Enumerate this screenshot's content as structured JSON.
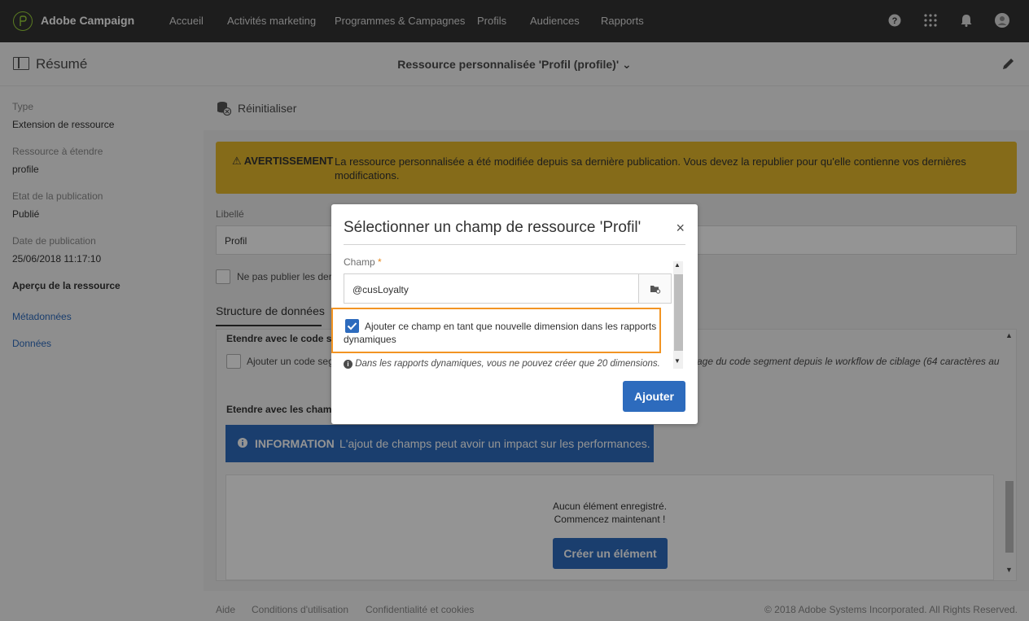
{
  "topnav": {
    "brand": "Adobe Campaign",
    "items": [
      "Accueil",
      "Activités marketing",
      "Programmes & Campagnes",
      "Profils",
      "Audiences",
      "Rapports"
    ],
    "icons": [
      "help-icon",
      "apps-grid-icon",
      "bell-icon",
      "avatar"
    ]
  },
  "header": {
    "summary_label": "Résumé",
    "resource_title": "Ressource personnalisée 'Profil (profile)' ⌄"
  },
  "left_panel": {
    "type_label": "Type",
    "type_value": "Extension de ressource",
    "resource_label": "Ressource à étendre",
    "resource_value": "profile",
    "state_label": "Etat de la publication",
    "state_value": "Publié",
    "date_label": "Date de publication",
    "date_value": "25/06/2018 11:17:10",
    "overview_heading": "Aperçu de la ressource",
    "links": [
      "Métadonnées",
      "Données"
    ]
  },
  "main": {
    "reset_label": "Réinitialiser",
    "warning_title": "AVERTISSEMENT",
    "warning_text": "La ressource personnalisée a été modifiée depuis sa dernière publication. Vous devez la republier pour qu'elle contienne vos dernières modifications.",
    "libelle_label": "Libellé",
    "libelle_value": "Profil",
    "no_publish_text": "Ne pas publier les derr",
    "tab_label": "Structure de données",
    "ext_segment_heading": "Etendre avec le code seg",
    "segment_cb_text": "Ajouter un code seg",
    "segment_italic_text": "age du code segment depuis le workflow de ciblage (64 caractères au",
    "ext_fields_heading": "Etendre avec les champs",
    "info_title": "INFORMATION",
    "info_text": "L'ajout de champs peut avoir un impact sur les performances.",
    "empty_line1": "Aucun élément enregistré.",
    "empty_line2": "Commencez maintenant !",
    "create_label": "Créer un élément"
  },
  "footer": {
    "links": [
      "Aide",
      "Conditions d'utilisation",
      "Confidentialité et cookies"
    ],
    "copyright": "© 2018 Adobe Systems Incorporated. All Rights Reserved."
  },
  "modal": {
    "title": "Sélectionner un champ de ressource 'Profil'",
    "close_glyph": "×",
    "champ_label": "Champ",
    "required_mark": "*",
    "champ_value": "@cusLoyalty",
    "dimension_checked": true,
    "dimension_text": "Ajouter ce champ en tant que nouvelle dimension dans les rapports dynamiques",
    "hint_text": "Dans les rapports dynamiques, vous ne pouvez créer que 20 dimensions.",
    "add_label": "Ajouter"
  },
  "colors": {
    "topnav_bg": "#323232",
    "accent_blue": "#2d6bbd",
    "warning_yellow": "#e5b92b",
    "highlight_orange": "#f29423",
    "logo_green": "#9bd33a"
  }
}
